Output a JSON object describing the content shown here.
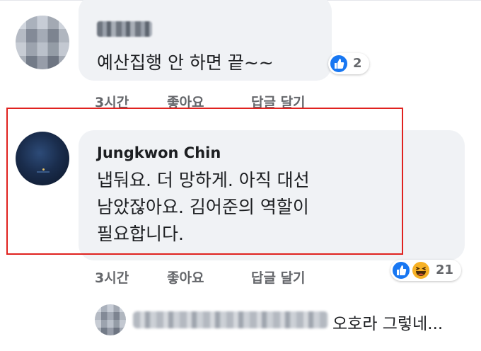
{
  "comments": [
    {
      "author_hidden": true,
      "text": "예산집행 안 하면 끝~~",
      "reaction_count": "2",
      "actions": {
        "time": "3시간",
        "like": "좋아요",
        "reply": "답글 달기"
      }
    },
    {
      "author": "Jungkwon Chin",
      "lines": [
        "냅둬요.  더 망하게. 아직 대선",
        "남았잖아요. 김어준의 역할이",
        "필요합니다."
      ],
      "reaction_count": "21",
      "actions": {
        "time": "3시간",
        "like": "좋아요",
        "reply": "답글 달기"
      }
    }
  ],
  "reply_preview": {
    "text": "오호라 그렇네..."
  },
  "colors": {
    "highlight": "#e0221f",
    "like_blue": "#1877f2",
    "haha_yellow": "#f7b125",
    "bubble": "#f0f2f5"
  }
}
